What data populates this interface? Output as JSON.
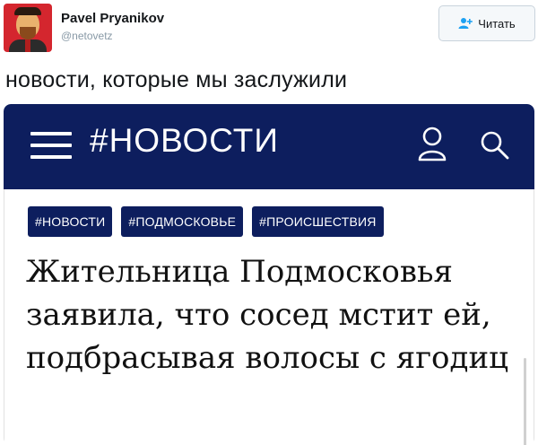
{
  "tweet": {
    "author_name": "Pavel Pryanikov",
    "author_handle": "@netovetz",
    "follow_label": "Читать",
    "text": "новости, которые мы заслужили"
  },
  "embed": {
    "site_logo": "#НОВОСТИ",
    "tags": [
      "#НОВОСТИ",
      "#ПОДМОСКОВЬЕ",
      "#ПРОИСШЕСТВИЯ"
    ],
    "headline": "Жительница Подмосковья заявила, что сосед мстит ей, подбрасывая волосы с ягодиц"
  },
  "colors": {
    "brand_navy": "#0d1e5e",
    "follow_blue": "#1da1f2",
    "avatar_red": "#d4262e"
  },
  "icons": {
    "menu": "hamburger-menu-icon",
    "user": "user-icon",
    "search": "search-icon",
    "follow": "person-add-icon"
  }
}
